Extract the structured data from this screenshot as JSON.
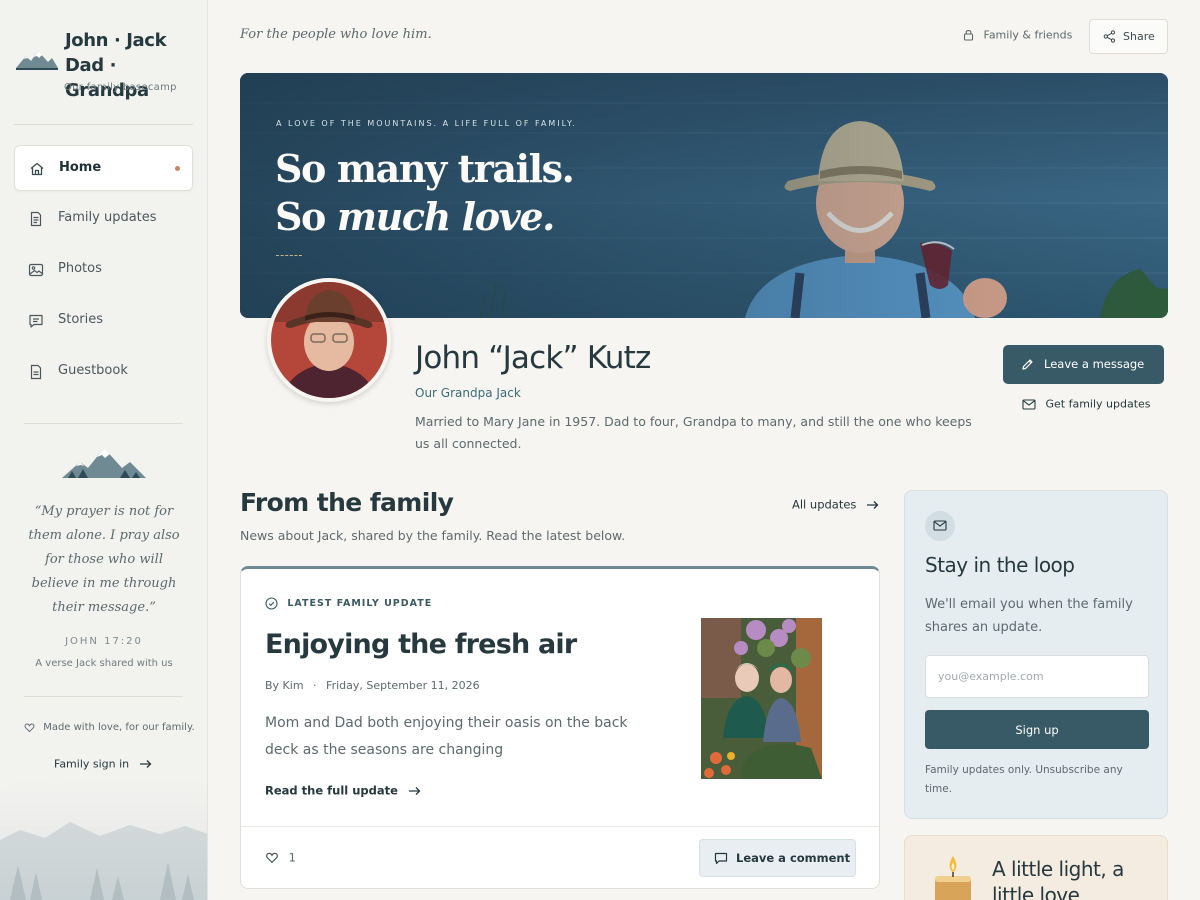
{
  "brand": {
    "title_line1": "John · Jack",
    "title_line2": "Dad · Grandpa",
    "subtitle": "Our family basecamp"
  },
  "nav": {
    "items": [
      {
        "label": "Home",
        "icon": "home-icon",
        "active": true
      },
      {
        "label": "Family updates",
        "icon": "document-icon"
      },
      {
        "label": "Photos",
        "icon": "image-icon"
      },
      {
        "label": "Stories",
        "icon": "message-icon"
      },
      {
        "label": "Guestbook",
        "icon": "book-icon"
      }
    ]
  },
  "sidebar_quote": {
    "text": "“My prayer is not for them alone. I pray also for those who will believe in me through their message.”",
    "reference": "JOHN 17:20",
    "note": "A verse Jack shared with us"
  },
  "sidebar_footer": {
    "made_with": "Made with love, for our family.",
    "signin": "Family sign in"
  },
  "topbar": {
    "tagline": "For the people who love him.",
    "privacy": "Family & friends",
    "share": "Share"
  },
  "hero": {
    "kicker": "A LOVE OF THE MOUNTAINS. A LIFE FULL OF FAMILY.",
    "line1": "So many trails.",
    "line2_prefix": "So ",
    "line2_italic": "much love."
  },
  "profile": {
    "name": "John “Jack” Kutz",
    "role": "Our Grandpa Jack",
    "bio": "Married to Mary Jane in 1957. Dad to four, Grandpa to many, and still the one who keeps us all connected.",
    "leave_message": "Leave a message",
    "get_updates": "Get family updates"
  },
  "updates": {
    "title": "From the family",
    "subtitle": "News about Jack, shared by the family. Read the latest below.",
    "all_link": "All updates",
    "latest": {
      "kicker": "LATEST FAMILY UPDATE",
      "title": "Enjoying the fresh air",
      "author": "By Kim",
      "separator": "·",
      "date": "Friday, September 11, 2026",
      "body": "Mom and Dad both enjoying their oasis on the back deck as the seasons are changing",
      "read_more": "Read the full update",
      "likes": "1",
      "comment": "Leave a comment"
    }
  },
  "newsletter": {
    "title": "Stay in the loop",
    "text": "We'll email you when the family shares an update.",
    "placeholder": "you@example.com",
    "button": "Sign up",
    "fine": "Family updates only. Unsubscribe any time."
  },
  "candle": {
    "title": "A little light, a little love"
  },
  "colors": {
    "accent": "#385a66",
    "nav_dot": "#c68468",
    "background": "#f6f5f1"
  }
}
